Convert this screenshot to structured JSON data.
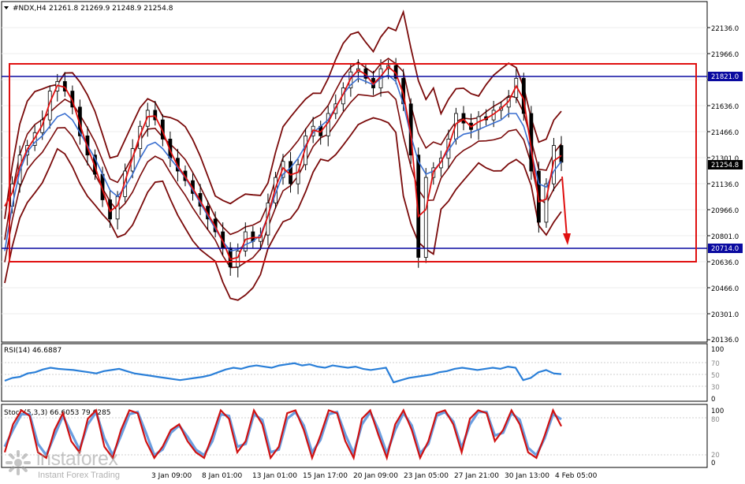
{
  "header": {
    "symbol": "#NDX,H4",
    "ohlc": "21261.8 21269.9 21248.9 21254.8"
  },
  "colors": {
    "price": "#000000",
    "bollinger": "#7a0a0a",
    "ma_fast": "#e01010",
    "ma_slow": "#3a6fd0",
    "box": "#e01010",
    "level": "#0a0aa0",
    "rsi": "#2a7fd8",
    "stoch_main": "#d01010",
    "stoch_signal": "#6a9ee0"
  },
  "chart_data": [
    {
      "type": "line",
      "name": "price",
      "x": [
        "3 Jan 09:00",
        "8 Jan 01:00",
        "13 Jan 01:00",
        "15 Jan 17:00",
        "20 Jan 09:00",
        "23 Jan 05:00",
        "27 Jan 21:00",
        "30 Jan 13:00",
        "4 Feb 05:00"
      ],
      "y_ticks": [
        21136.0,
        21966.0,
        21801.0,
        21636.0,
        21466.0,
        21301.0,
        21136.0,
        20966.0,
        20801.0,
        20636.0,
        20466.0,
        20301.0,
        20136.0
      ],
      "ylim": [
        20130,
        22260
      ],
      "series": [
        {
          "values": [
            20980,
            21120,
            21300,
            21360,
            21440,
            21520,
            21700,
            21760,
            21700,
            21600,
            21420,
            21300,
            21180,
            21020,
            20900,
            21040,
            21200,
            21340,
            21480,
            21580,
            21520,
            21400,
            21280,
            21200,
            21140,
            21060,
            20980,
            20900,
            20820,
            20720,
            20600,
            20700,
            20820,
            20760,
            20800,
            21000,
            21160,
            21260,
            21120,
            21240,
            21420,
            21480,
            21420,
            21560,
            21620,
            21720,
            21820,
            21840,
            21780,
            21720,
            21840,
            21860,
            21780,
            21620,
            21300,
            20660,
            21160,
            21220,
            21280,
            21400,
            21560,
            21500,
            21460,
            21540,
            21520,
            21580,
            21600,
            21660,
            21780,
            21560,
            21200,
            20880,
            21120,
            21360,
            21254.8
          ]
        },
        {
          "values": [
            20700,
            20980,
            21200,
            21320,
            21380,
            21420,
            21480,
            21540,
            21560,
            21520,
            21440,
            21360,
            21280,
            21180,
            21080,
            21040,
            21100,
            21180,
            21280,
            21360,
            21380,
            21340,
            21280,
            21220,
            21160,
            21080,
            21000,
            20920,
            20840,
            20760,
            20700,
            20710,
            20740,
            20760,
            20800,
            20920,
            21060,
            21180,
            21220,
            21280,
            21360,
            21440,
            21480,
            21520,
            21600,
            21680,
            21740,
            21780,
            21760,
            21740,
            21780,
            21800,
            21760,
            21620,
            21420,
            21260,
            21180,
            21200,
            21260,
            21330,
            21400,
            21430,
            21440,
            21460,
            21480,
            21500,
            21520,
            21560,
            21560,
            21480,
            21320,
            21120,
            21100,
            21200,
            21260
          ]
        }
      ],
      "levels": [
        21821.0,
        20714.0
      ],
      "current": 21254.8
    },
    {
      "type": "line",
      "title": "RSI(14) 46.6887",
      "y_ticks": [
        100,
        70,
        50,
        30,
        0
      ],
      "ylim": [
        0,
        100
      ],
      "values": [
        35,
        40,
        42,
        48,
        50,
        55,
        58,
        56,
        55,
        54,
        52,
        50,
        48,
        52,
        54,
        56,
        52,
        48,
        46,
        44,
        42,
        40,
        38,
        36,
        38,
        40,
        42,
        45,
        50,
        55,
        58,
        56,
        60,
        62,
        60,
        58,
        62,
        64,
        66,
        62,
        64,
        60,
        58,
        62,
        60,
        58,
        60,
        56,
        54,
        56,
        58,
        32,
        36,
        40,
        42,
        44,
        46,
        50,
        52,
        56,
        58,
        56,
        54,
        56,
        58,
        56,
        60,
        58,
        36,
        40,
        50,
        54,
        48,
        46.69
      ]
    },
    {
      "type": "line",
      "title": "Stoch(5,3,3) 66.6053 79.0285",
      "y_ticks": [
        100,
        80,
        20,
        0
      ],
      "ylim": [
        0,
        100
      ],
      "series": [
        {
          "name": "main",
          "values": [
            20,
            70,
            95,
            85,
            20,
            10,
            60,
            90,
            40,
            20,
            80,
            95,
            30,
            10,
            60,
            95,
            90,
            40,
            10,
            30,
            60,
            70,
            40,
            20,
            10,
            50,
            95,
            80,
            20,
            40,
            95,
            70,
            10,
            30,
            90,
            95,
            60,
            10,
            50,
            95,
            90,
            40,
            10,
            80,
            95,
            50,
            10,
            70,
            95,
            60,
            10,
            40,
            90,
            95,
            70,
            20,
            80,
            95,
            90,
            40,
            60,
            95,
            70,
            20,
            10,
            50,
            95,
            66.61
          ]
        },
        {
          "name": "signal",
          "values": [
            30,
            60,
            88,
            88,
            35,
            15,
            50,
            85,
            55,
            25,
            70,
            92,
            45,
            15,
            50,
            88,
            92,
            55,
            15,
            25,
            55,
            68,
            48,
            25,
            15,
            40,
            88,
            85,
            30,
            35,
            88,
            78,
            20,
            25,
            80,
            92,
            68,
            20,
            42,
            88,
            92,
            52,
            18,
            70,
            92,
            60,
            18,
            60,
            90,
            68,
            18,
            35,
            85,
            92,
            75,
            28,
            70,
            92,
            92,
            50,
            55,
            90,
            78,
            28,
            15,
            45,
            88,
            79.03
          ]
        }
      ]
    }
  ],
  "price_axis": {
    "labels": [
      "22136.0",
      "21966.0",
      "21801.0",
      "21636.0",
      "21466.0",
      "21301.0",
      "21136.0",
      "20966.0",
      "20801.0",
      "20636.0",
      "20466.0",
      "20301.0",
      "20136.0"
    ],
    "level_high_label": "21821.0",
    "level_low_label": "20714.0",
    "current_label": "21254.8"
  },
  "rsi_axis": {
    "labels": [
      "100",
      "70",
      "50",
      "30",
      "0"
    ]
  },
  "stoch_axis": {
    "labels": [
      "100",
      "80",
      "20",
      "0"
    ]
  },
  "time_axis": {
    "labels": [
      "3 Jan 09:00",
      "8 Jan 01:00",
      "13 Jan 01:00",
      "15 Jan 17:00",
      "20 Jan 09:00",
      "23 Jan 05:00",
      "27 Jan 21:00",
      "30 Jan 13:00",
      "4 Feb 05:00"
    ]
  },
  "watermark": {
    "name": "instaforex",
    "tagline": "Instant Forex Trading"
  }
}
